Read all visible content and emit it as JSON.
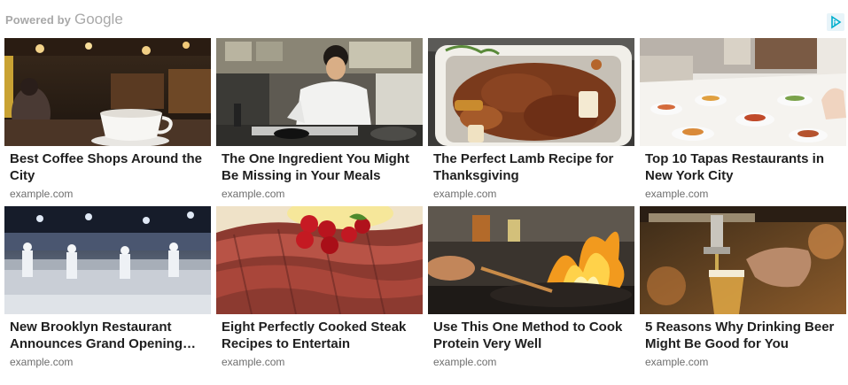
{
  "header": {
    "powered_label": "Powered by",
    "google_label": "Google"
  },
  "ads": [
    {
      "title": "Best Coffee Shops Around the City",
      "domain": "example.com",
      "image": "coffee-shop-photo"
    },
    {
      "title": "The One Ingredient You Might Be Missing in Your Meals",
      "domain": "example.com",
      "image": "chef-cooking-photo"
    },
    {
      "title": "The Perfect Lamb Recipe for Thanksgiving",
      "domain": "example.com",
      "image": "lamb-roast-photo"
    },
    {
      "title": "Top 10 Tapas Restaurants in New York City",
      "domain": "example.com",
      "image": "tapas-table-photo"
    },
    {
      "title": "New Brooklyn Restaurant Announces Grand Opening…",
      "domain": "example.com",
      "image": "restaurant-kitchen-photo"
    },
    {
      "title": "Eight Perfectly Cooked Steak Recipes to Entertain",
      "domain": "example.com",
      "image": "steak-photo"
    },
    {
      "title": "Use This One Method to Cook Protein Very Well",
      "domain": "example.com",
      "image": "wok-flame-photo"
    },
    {
      "title": "5 Reasons Why Drinking Beer Might Be Good for You",
      "domain": "example.com",
      "image": "beer-tap-photo"
    }
  ],
  "colors": {
    "title_text": "#202020",
    "domain_text": "#6e6e6e",
    "attribution_text": "#a8a8a8",
    "adchoices_icon": "#00aecd"
  }
}
